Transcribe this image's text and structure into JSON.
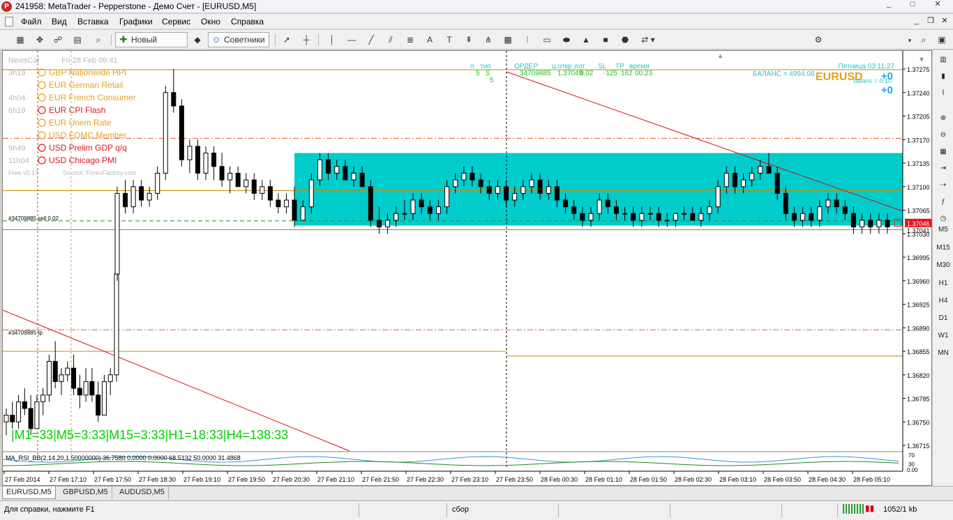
{
  "window": {
    "title": "241958: MetaTrader - Pepperstone - Демо Счет - [EURUSD,M5]",
    "logo_glyph": "P"
  },
  "menu": [
    "Файл",
    "Вид",
    "Вставка",
    "Графики",
    "Сервис",
    "Окно",
    "Справка"
  ],
  "toolbar": {
    "new_order": "Новый Ордер",
    "experts": "Советники"
  },
  "news": {
    "header_left": "NewsCal",
    "header_right": "Fri 28 Feb 09:41",
    "footer_left": "Free v0.17",
    "footer_right": "Source: ForexFactory.com",
    "items": [
      {
        "time": "3h19",
        "currency": "GBP",
        "name": "Nationwide HPI",
        "color": "#e6a020"
      },
      {
        "time": "",
        "currency": "EUR",
        "name": "German Retail",
        "color": "#e6a020"
      },
      {
        "time": "4h04",
        "currency": "EUR",
        "name": "French Consumer",
        "color": "#e6a020"
      },
      {
        "time": "6h19",
        "currency": "EUR",
        "name": "CPI Flash",
        "color": "#e0161e"
      },
      {
        "time": "",
        "currency": "EUR",
        "name": "Unem Rate",
        "color": "#e6a020"
      },
      {
        "time": "",
        "currency": "USD",
        "name": "FOMC Member",
        "color": "#e6a020"
      },
      {
        "time": "9h49",
        "currency": "USD",
        "name": "Prelim GDP q/q",
        "color": "#e0161e"
      },
      {
        "time": "11h04",
        "currency": "USD",
        "name": "Chicago PMI",
        "color": "#e0161e"
      }
    ]
  },
  "order_panel": {
    "headers": [
      "п",
      "тип",
      "ОРДЕР",
      "ц.откр",
      "лот",
      "SL",
      "TP",
      "время"
    ],
    "row": [
      "5",
      "S",
      "34709885",
      "1.37049",
      "0.02",
      "-125",
      "162",
      "00:23"
    ],
    "row2": "5",
    "server_time": "Пятница 03:11:27",
    "balance": "БАЛАНС = 4994.08",
    "symbol": "EURUSD",
    "pips_a": "+0",
    "pips_b": "+0",
    "balans_label": "balans = 0.10"
  },
  "line_labels": {
    "sell": "#34709885 sell 0.02",
    "tp": "#34709885 tp"
  },
  "timeframe_text": "|M1=33|M5=3:33|M15=3:33|H1=18:33|H4=138:33",
  "indicator_label": "MA_RSI_BB(2,14,20,1.50000000) 36.7580 0.0000 0.0000 68.5132 50.0000 31.4868",
  "indicator_scale": [
    "70",
    "30",
    "0.00"
  ],
  "chart_data": {
    "type": "candlestick",
    "symbol": "EURUSD",
    "timeframe": "M5",
    "y_ticks": [
      1.37275,
      1.3724,
      1.37205,
      1.3717,
      1.37135,
      1.371,
      1.37065,
      1.3703,
      1.36995,
      1.3696,
      1.36925,
      1.3689,
      1.36855,
      1.3682,
      1.36785,
      1.3675,
      1.36715
    ],
    "x_ticks": [
      "27 Feb 2014",
      "27 Feb 17:10",
      "27 Feb 17:50",
      "27 Feb 18:30",
      "27 Feb 19:10",
      "27 Feb 19:50",
      "27 Feb 20:30",
      "27 Feb 21:10",
      "27 Feb 21:50",
      "27 Feb 22:30",
      "27 Feb 23:10",
      "27 Feb 23:50",
      "28 Feb 00:30",
      "28 Feb 01:10",
      "28 Feb 01:50",
      "28 Feb 02:30",
      "28 Feb 03:10",
      "28 Feb 03:50",
      "28 Feb 04:30",
      "28 Feb 05:10"
    ],
    "current_price": "1.37046",
    "current_price_value": 1.37046,
    "second_price": "1.37041",
    "rectangle": {
      "price_top": 1.3715,
      "price_bottom": 1.37042,
      "color": "#00cccc"
    },
    "levels": {
      "sell": 1.37049,
      "tp": 1.36887,
      "high_level": 1.37274,
      "mid_level": 1.37094,
      "dash_level": 1.37172,
      "low_level_left": 1.36855,
      "low_level_right": 1.36848,
      "current_level": 1.37036
    },
    "candles": [
      [
        1.3675,
        1.3677,
        1.3673,
        1.3676
      ],
      [
        1.3676,
        1.3678,
        1.3674,
        1.3675
      ],
      [
        1.3675,
        1.3679,
        1.3674,
        1.3678
      ],
      [
        1.3678,
        1.368,
        1.3676,
        1.3677
      ],
      [
        1.3677,
        1.3679,
        1.3673,
        1.3674
      ],
      [
        1.3674,
        1.3679,
        1.3674,
        1.3678
      ],
      [
        1.3678,
        1.368,
        1.3676,
        1.3679
      ],
      [
        1.3679,
        1.3685,
        1.3678,
        1.3684
      ],
      [
        1.3684,
        1.3687,
        1.368,
        1.3681
      ],
      [
        1.3681,
        1.3683,
        1.3679,
        1.3682
      ],
      [
        1.3682,
        1.3684,
        1.3681,
        1.3683
      ],
      [
        1.3683,
        1.3685,
        1.3679,
        1.368
      ],
      [
        1.368,
        1.3682,
        1.3677,
        1.3679
      ],
      [
        1.3679,
        1.3683,
        1.3678,
        1.3681
      ],
      [
        1.3681,
        1.3683,
        1.3678,
        1.3679
      ],
      [
        1.3679,
        1.3681,
        1.3675,
        1.3676
      ],
      [
        1.3676,
        1.3682,
        1.3676,
        1.3681
      ],
      [
        1.3681,
        1.3683,
        1.3679,
        1.3682
      ],
      [
        1.3682,
        1.3698,
        1.3681,
        1.3697
      ],
      [
        1.3697,
        1.371,
        1.3696,
        1.3709
      ],
      [
        1.3709,
        1.3711,
        1.3706,
        1.3707
      ],
      [
        1.3707,
        1.3711,
        1.3706,
        1.371
      ],
      [
        1.371,
        1.3711,
        1.3707,
        1.3708
      ],
      [
        1.3708,
        1.371,
        1.3707,
        1.3709
      ],
      [
        1.3709,
        1.3713,
        1.3708,
        1.3712
      ],
      [
        1.3712,
        1.3725,
        1.3711,
        1.3724
      ],
      [
        1.3724,
        1.37275,
        1.3721,
        1.3722
      ],
      [
        1.3722,
        1.3723,
        1.3713,
        1.3714
      ],
      [
        1.3714,
        1.3717,
        1.3712,
        1.3716
      ],
      [
        1.3716,
        1.3717,
        1.3711,
        1.3712
      ],
      [
        1.3712,
        1.3716,
        1.3711,
        1.3715
      ],
      [
        1.3715,
        1.3716,
        1.3711,
        1.3713
      ],
      [
        1.3713,
        1.3715,
        1.371,
        1.3711
      ],
      [
        1.3711,
        1.3713,
        1.3709,
        1.3712
      ],
      [
        1.3712,
        1.3713,
        1.371,
        1.371
      ],
      [
        1.371,
        1.3712,
        1.3709,
        1.3711
      ],
      [
        1.3711,
        1.3712,
        1.3708,
        1.3709
      ],
      [
        1.3709,
        1.3711,
        1.3708,
        1.371
      ],
      [
        1.371,
        1.3711,
        1.3707,
        1.3708
      ],
      [
        1.3708,
        1.3709,
        1.3706,
        1.3707
      ],
      [
        1.3707,
        1.3709,
        1.3706,
        1.3708
      ],
      [
        1.3708,
        1.371,
        1.3707,
        1.3708
      ],
      [
        1.3708,
        1.3709,
        1.3704,
        1.3705
      ],
      [
        1.3705,
        1.3708,
        1.3705,
        1.3707
      ],
      [
        1.3707,
        1.3712,
        1.3706,
        1.3711
      ],
      [
        1.3711,
        1.3715,
        1.371,
        1.3714
      ],
      [
        1.3714,
        1.3715,
        1.3711,
        1.3712
      ],
      [
        1.3712,
        1.3714,
        1.3711,
        1.3713
      ],
      [
        1.3713,
        1.3714,
        1.3711,
        1.3711
      ],
      [
        1.3711,
        1.3713,
        1.371,
        1.3712
      ],
      [
        1.3712,
        1.3713,
        1.371,
        1.371
      ],
      [
        1.371,
        1.3711,
        1.3704,
        1.3705
      ],
      [
        1.3705,
        1.3707,
        1.3703,
        1.3704
      ],
      [
        1.3704,
        1.3706,
        1.3703,
        1.3705
      ],
      [
        1.3705,
        1.3707,
        1.3704,
        1.3706
      ],
      [
        1.3706,
        1.3708,
        1.3705,
        1.3706
      ],
      [
        1.3706,
        1.3709,
        1.3705,
        1.3708
      ],
      [
        1.3708,
        1.3709,
        1.3706,
        1.3707
      ],
      [
        1.3707,
        1.3708,
        1.3705,
        1.3706
      ],
      [
        1.3706,
        1.3708,
        1.3705,
        1.3707
      ],
      [
        1.3707,
        1.3711,
        1.3706,
        1.371
      ],
      [
        1.371,
        1.3712,
        1.3709,
        1.3711
      ],
      [
        1.3711,
        1.3713,
        1.371,
        1.3712
      ],
      [
        1.3712,
        1.3713,
        1.371,
        1.3711
      ],
      [
        1.3711,
        1.3712,
        1.3709,
        1.371
      ],
      [
        1.371,
        1.3711,
        1.3708,
        1.3709
      ],
      [
        1.3709,
        1.3711,
        1.3708,
        1.371
      ],
      [
        1.371,
        1.3711,
        1.3707,
        1.3708
      ],
      [
        1.3708,
        1.371,
        1.3707,
        1.3709
      ],
      [
        1.3709,
        1.3711,
        1.3708,
        1.371
      ],
      [
        1.371,
        1.3712,
        1.3709,
        1.3711
      ],
      [
        1.3711,
        1.3712,
        1.3708,
        1.3709
      ],
      [
        1.3709,
        1.3711,
        1.3708,
        1.371
      ],
      [
        1.371,
        1.3711,
        1.3707,
        1.3708
      ],
      [
        1.3708,
        1.3709,
        1.3706,
        1.3707
      ],
      [
        1.3707,
        1.3708,
        1.3705,
        1.3706
      ],
      [
        1.3706,
        1.3707,
        1.3704,
        1.3705
      ],
      [
        1.3705,
        1.3707,
        1.3704,
        1.3706
      ],
      [
        1.3706,
        1.3709,
        1.3705,
        1.3708
      ],
      [
        1.3708,
        1.3709,
        1.3706,
        1.3707
      ],
      [
        1.3707,
        1.3708,
        1.3705,
        1.3706
      ],
      [
        1.3706,
        1.3707,
        1.3705,
        1.3706
      ],
      [
        1.3706,
        1.3707,
        1.3704,
        1.3705
      ],
      [
        1.3705,
        1.3707,
        1.3704,
        1.3706
      ],
      [
        1.3706,
        1.3707,
        1.3705,
        1.3706
      ],
      [
        1.3706,
        1.3707,
        1.3704,
        1.3705
      ],
      [
        1.3705,
        1.3706,
        1.3704,
        1.3705
      ],
      [
        1.3705,
        1.3706,
        1.3704,
        1.3706
      ],
      [
        1.3706,
        1.3707,
        1.3705,
        1.3706
      ],
      [
        1.3706,
        1.3707,
        1.3705,
        1.3705
      ],
      [
        1.3705,
        1.3707,
        1.3704,
        1.3706
      ],
      [
        1.3706,
        1.3708,
        1.3705,
        1.3707
      ],
      [
        1.3707,
        1.3711,
        1.3706,
        1.371
      ],
      [
        1.371,
        1.3713,
        1.3709,
        1.3712
      ],
      [
        1.3712,
        1.3713,
        1.3709,
        1.371
      ],
      [
        1.371,
        1.3712,
        1.3709,
        1.3711
      ],
      [
        1.3711,
        1.3713,
        1.371,
        1.3712
      ],
      [
        1.3712,
        1.3714,
        1.3711,
        1.3713
      ],
      [
        1.3713,
        1.3715,
        1.3712,
        1.3712
      ],
      [
        1.3712,
        1.3713,
        1.3708,
        1.3709
      ],
      [
        1.3709,
        1.371,
        1.3705,
        1.3706
      ],
      [
        1.3706,
        1.3707,
        1.3704,
        1.3705
      ],
      [
        1.3705,
        1.3707,
        1.3704,
        1.3706
      ],
      [
        1.3706,
        1.3707,
        1.3704,
        1.3705
      ],
      [
        1.3705,
        1.3708,
        1.3704,
        1.3707
      ],
      [
        1.3707,
        1.3709,
        1.3706,
        1.3708
      ],
      [
        1.3708,
        1.3709,
        1.3706,
        1.3707
      ],
      [
        1.3707,
        1.3708,
        1.3705,
        1.3706
      ],
      [
        1.3706,
        1.3707,
        1.3703,
        1.3704
      ],
      [
        1.3704,
        1.3706,
        1.3703,
        1.3705
      ],
      [
        1.3705,
        1.3706,
        1.3703,
        1.3704
      ],
      [
        1.3704,
        1.3706,
        1.3703,
        1.3705
      ],
      [
        1.3705,
        1.3706,
        1.3703,
        1.3704
      ]
    ]
  },
  "tabs": [
    "EURUSD,M5",
    "GBPUSD,M5",
    "AUDUSD,M5"
  ],
  "status": {
    "help": "Для справки, нажмите F1",
    "profile": "сбор",
    "traffic": "1052/1 kb"
  },
  "right_toolbar": [
    "M5",
    "M15",
    "M30",
    "H1",
    "H4",
    "D1",
    "W1",
    "MN"
  ],
  "colors": {
    "candle": "#000000",
    "levels": "#c88a00",
    "trend": "#cc1010",
    "tp_line": "#e05a30",
    "timeframe_text": "#00d000"
  }
}
